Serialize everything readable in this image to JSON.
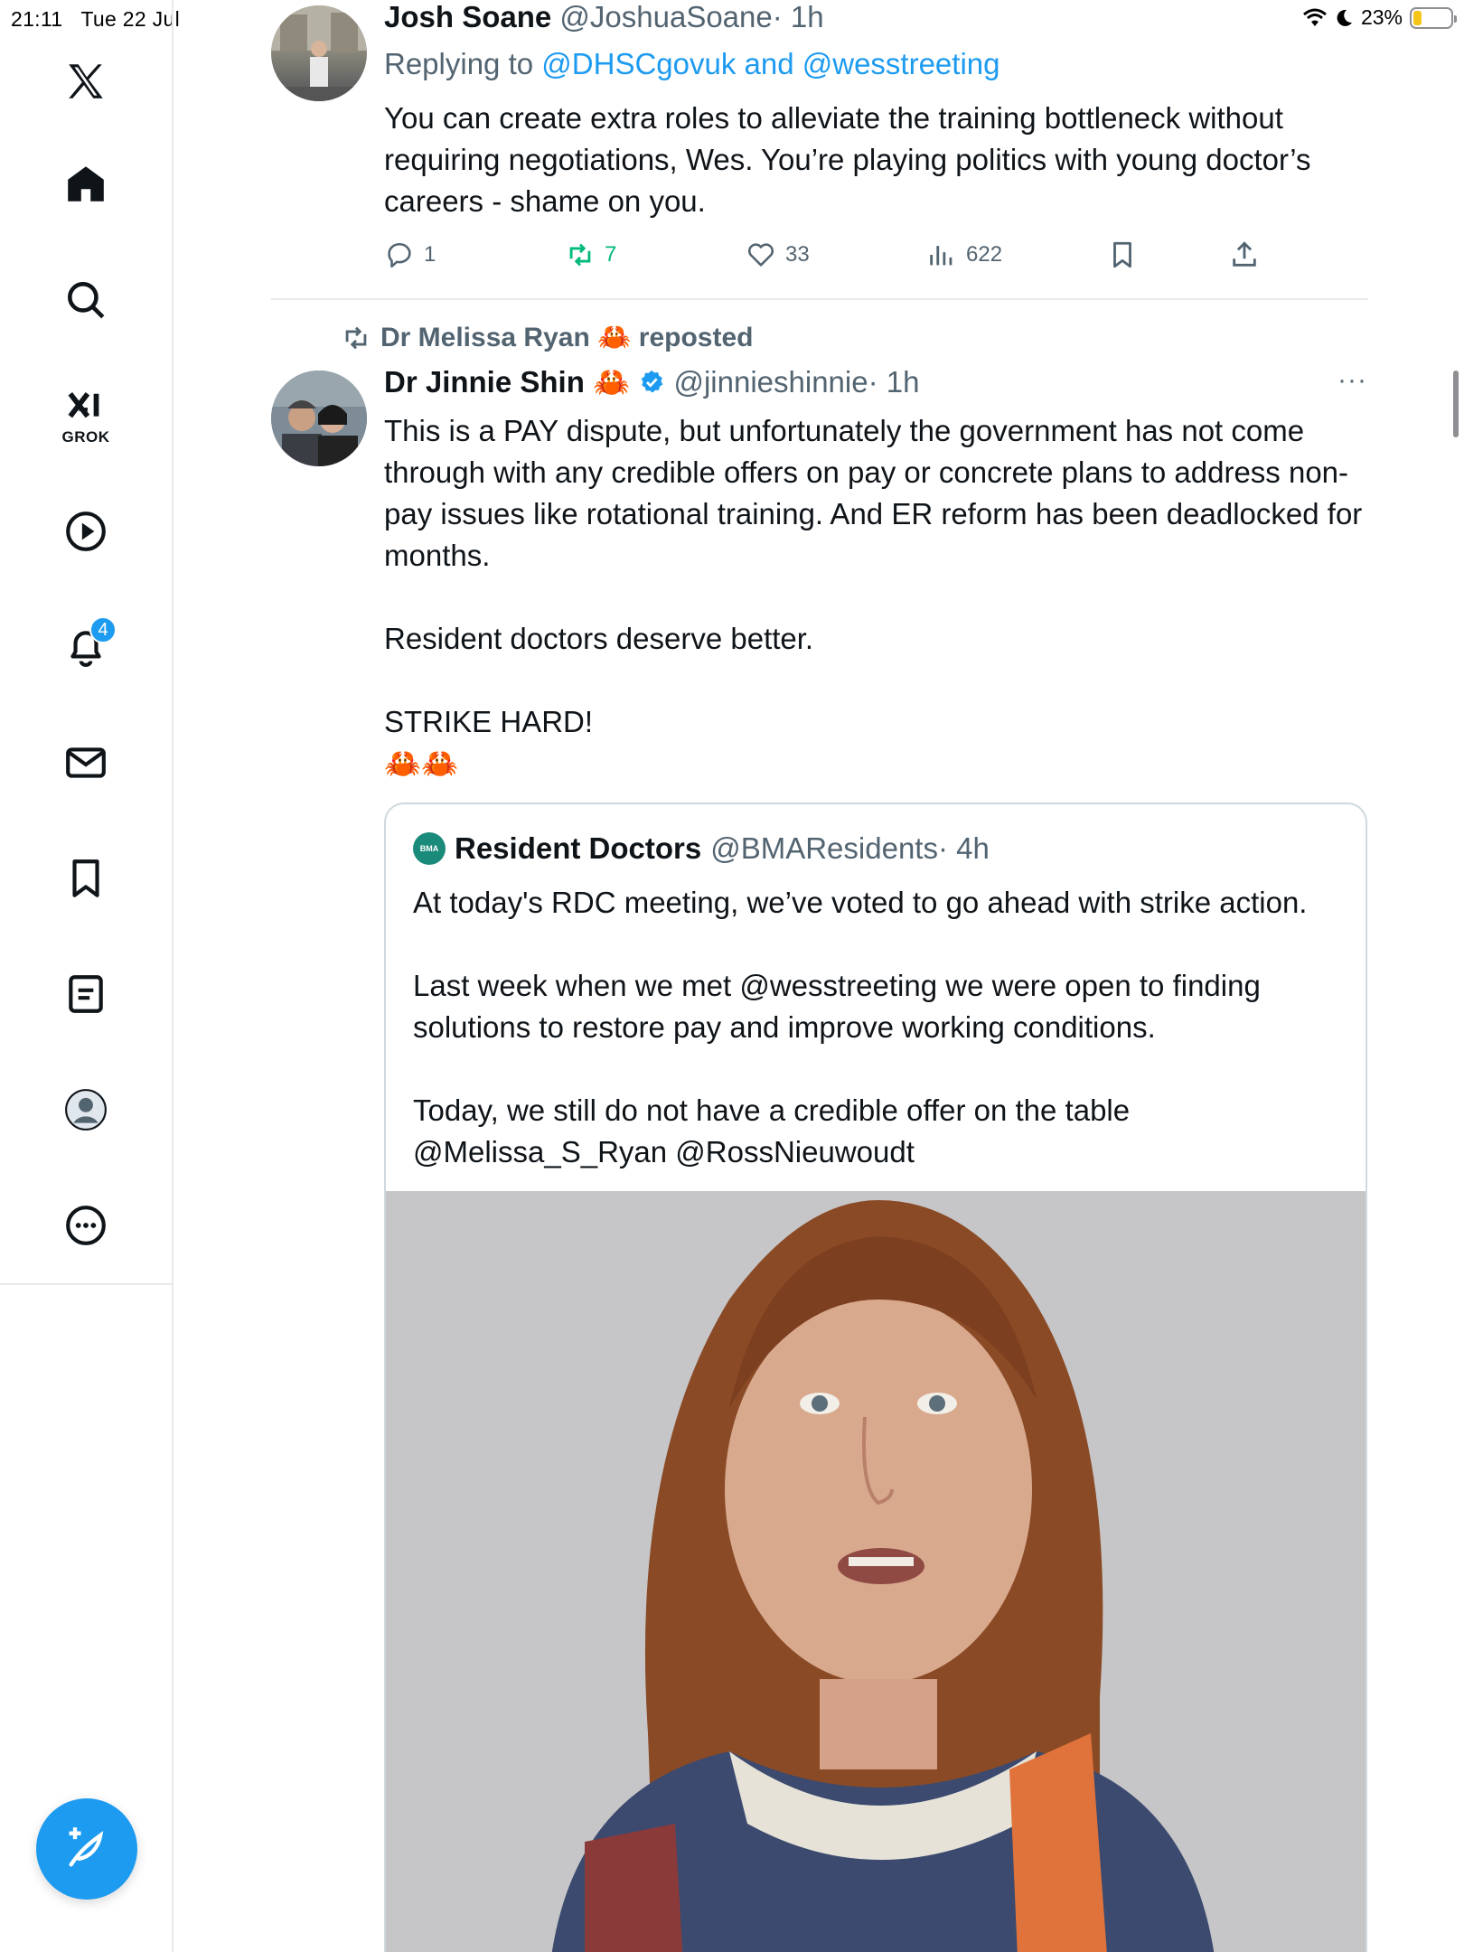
{
  "status_bar": {
    "time": "21:11",
    "date": "Tue 22 Jul",
    "battery": "23%",
    "battery_level": 0.23
  },
  "sidebar": {
    "items": [
      {
        "name": "home",
        "label": "Home"
      },
      {
        "name": "explore",
        "label": "Explore"
      },
      {
        "name": "grok",
        "label": "GROK"
      },
      {
        "name": "video",
        "label": "Video"
      },
      {
        "name": "notifications",
        "label": "Notifications",
        "badge": "4"
      },
      {
        "name": "messages",
        "label": "Messages"
      },
      {
        "name": "bookmarks",
        "label": "Bookmarks"
      },
      {
        "name": "lists",
        "label": "Lists"
      },
      {
        "name": "profile",
        "label": "Profile"
      },
      {
        "name": "more",
        "label": "More"
      }
    ],
    "compose_label": "Post"
  },
  "tweet1": {
    "name": "Josh Soane",
    "handle": "@JoshuaSoane",
    "time": "· 1h",
    "replying_prefix": "Replying to",
    "replying_to": "@DHSCgovuk and @wesstreeting",
    "text": "You can create extra roles to alleviate the training bottleneck without requiring negotiations, Wes. You’re playing politics with young doctor’s careers - shame on you.",
    "replies": "1",
    "reposts": "7",
    "likes": "33",
    "views": "622"
  },
  "tweet2": {
    "repost_by": "Dr Melissa Ryan 🦀 reposted",
    "name": "Dr Jinnie Shin 🦀",
    "handle": "@jinnieshinnie",
    "time": "· 1h",
    "more": "···",
    "paragraphs": [
      "This is a PAY dispute, but unfortunately the government has not come through with any credible offers on pay or concrete plans to address non-pay issues like rotational training. And ER reform has been deadlocked for months.",
      "Resident doctors deserve better.",
      "STRIKE HARD!",
      "🦀🦀"
    ]
  },
  "quote": {
    "logo": "BMA",
    "name": "Resident Doctors",
    "handle": "@BMAResidents",
    "time": "· 4h",
    "paragraphs": [
      "At today's RDC meeting, we’ve voted to go ahead with strike action.",
      "Last week when we met @wesstreeting we were open to finding solutions to restore pay and improve working conditions.",
      "Today, we still do not have a credible offer on the table @Melissa_S_Ryan @RossNieuwoudt"
    ]
  },
  "colors": {
    "accent": "#1d9bf0",
    "repost_green": "#00ba7c",
    "muted": "#536471",
    "border": "#e7e9ea"
  }
}
